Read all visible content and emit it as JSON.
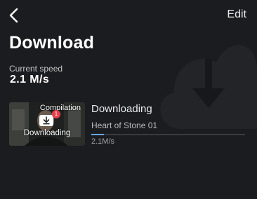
{
  "header": {
    "edit_label": "Edit"
  },
  "page": {
    "title": "Download",
    "speed_label": "Current speed",
    "speed_value": "2.1 M/s"
  },
  "download_item": {
    "thumbnail_tag": "Compilation",
    "thumbnail_status": "Downloading",
    "badge_count": "1",
    "status": "Downloading",
    "episode_title": "Heart of Stone 01",
    "progress_fraction": 0.08,
    "rate": "2.1M/s",
    "progress_color": "#6aa8ff",
    "badge_color": "#ea3e4b"
  },
  "icons": {
    "back": "chevron-left-icon",
    "thumbnail_download": "download-icon",
    "background": "cloud-download-icon"
  }
}
